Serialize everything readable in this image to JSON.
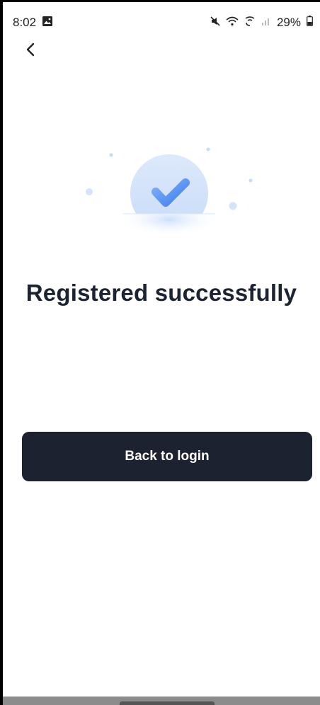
{
  "status_bar": {
    "time": "8:02",
    "battery": "29%",
    "icons": [
      "gallery-icon",
      "mute-icon",
      "wifi-icon",
      "wifi-calling-icon",
      "signal-icon",
      "battery-icon"
    ]
  },
  "header": {
    "back_icon": "chevron-left-icon"
  },
  "illustration": {
    "icon": "checkmark-icon",
    "accent": "#4e8ff3"
  },
  "main": {
    "title": "Registered successfully",
    "button_label": "Back to login"
  },
  "colors": {
    "button_bg": "#1d2230",
    "title": "#1c2331"
  }
}
